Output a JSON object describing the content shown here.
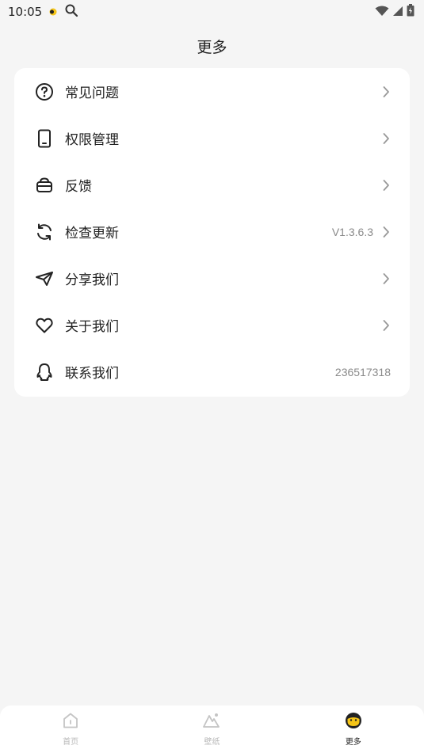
{
  "status_bar": {
    "time": "10:05",
    "icons": [
      "notification-dot-icon",
      "search-icon",
      "wifi-icon",
      "cellular-icon",
      "battery-icon"
    ]
  },
  "header": {
    "title": "更多"
  },
  "menu": {
    "items": [
      {
        "label": "常见问题",
        "icon": "help-circle-icon",
        "value": "",
        "chevron": true
      },
      {
        "label": "权限管理",
        "icon": "phone-icon",
        "value": "",
        "chevron": true
      },
      {
        "label": "反馈",
        "icon": "feedback-icon",
        "value": "",
        "chevron": true
      },
      {
        "label": "检查更新",
        "icon": "refresh-icon",
        "value": "V1.3.6.3",
        "chevron": true
      },
      {
        "label": "分享我们",
        "icon": "send-icon",
        "value": "",
        "chevron": true
      },
      {
        "label": "关于我们",
        "icon": "heart-icon",
        "value": "",
        "chevron": true
      },
      {
        "label": "联系我们",
        "icon": "qq-icon",
        "value": "236517318",
        "chevron": false
      }
    ]
  },
  "bottom_nav": {
    "tabs": [
      {
        "label": "首页",
        "icon": "home-icon",
        "active": false
      },
      {
        "label": "壁纸",
        "icon": "wallpaper-icon",
        "active": false
      },
      {
        "label": "更多",
        "icon": "more-face-icon",
        "active": true
      }
    ]
  },
  "colors": {
    "accent": "#f5c518",
    "text": "#222222",
    "muted": "#8a8a8a",
    "inactive": "#b8b8b8"
  }
}
